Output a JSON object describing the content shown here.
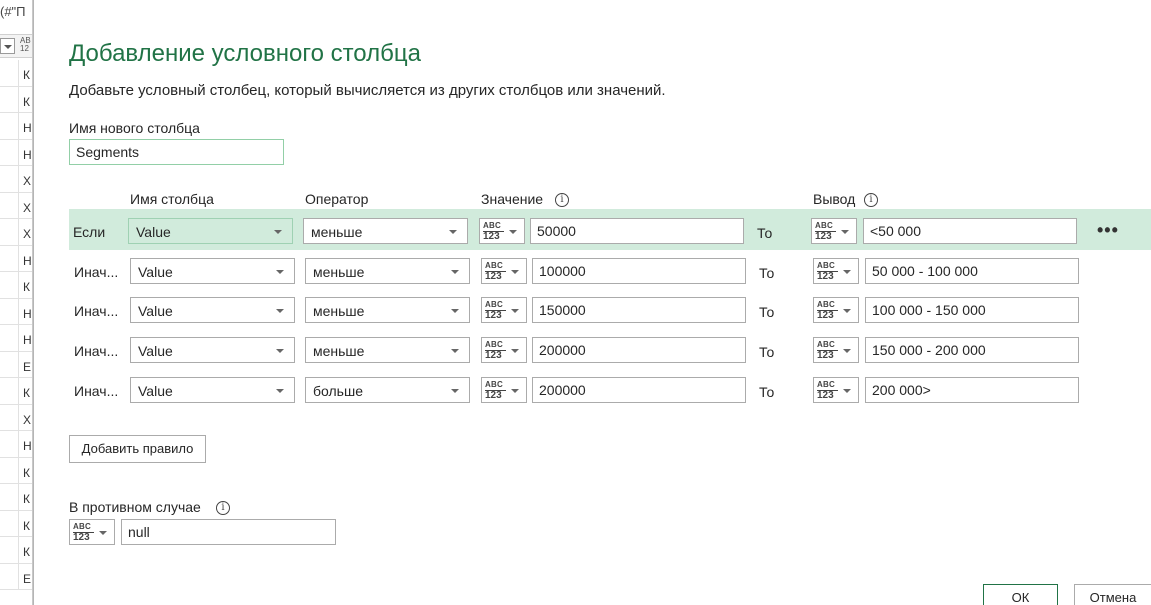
{
  "background": {
    "formula_fragment": "(#\"П",
    "type_icon": {
      "line1": "AB",
      "line2": "12"
    },
    "row_letters": [
      "К",
      "К",
      "Н",
      "Н",
      "Х",
      "Х",
      "Х",
      "Н",
      "К",
      "Н",
      "Н",
      "Е",
      "К",
      "Х",
      "Н",
      "К",
      "К",
      "К",
      "К",
      "Е"
    ]
  },
  "dialog": {
    "title": "Добавление условного столбца",
    "description": "Добавьте условный столбец, который вычисляется из других столбцов или значений.",
    "new_column_label": "Имя нового столбца",
    "new_column_value": "Segments",
    "headers": {
      "column_name": "Имя столбца",
      "operator": "Оператор",
      "value": "Значение",
      "output": "Вывод"
    },
    "type_icon": {
      "line1": "ABC",
      "line2": "123"
    },
    "to_label": "То",
    "rules": [
      {
        "label": "Если",
        "column": "Value",
        "operator": "меньше",
        "value": "50000",
        "output": "<50 000"
      },
      {
        "label": "Инач...",
        "column": "Value",
        "operator": "меньше",
        "value": "100000",
        "output": "50 000 - 100 000"
      },
      {
        "label": "Инач...",
        "column": "Value",
        "operator": "меньше",
        "value": "150000",
        "output": "100 000 - 150 000"
      },
      {
        "label": "Инач...",
        "column": "Value",
        "operator": "меньше",
        "value": "200000",
        "output": "150 000 - 200 000"
      },
      {
        "label": "Инач...",
        "column": "Value",
        "operator": "больше",
        "value": "200000",
        "output": "200 000>"
      }
    ],
    "more_label": "•••",
    "add_rule_label": "Добавить правило",
    "else_label": "В противном случае",
    "else_value": "null",
    "ok_label": "ОК",
    "cancel_label": "Отмена",
    "info_glyph": "i"
  }
}
